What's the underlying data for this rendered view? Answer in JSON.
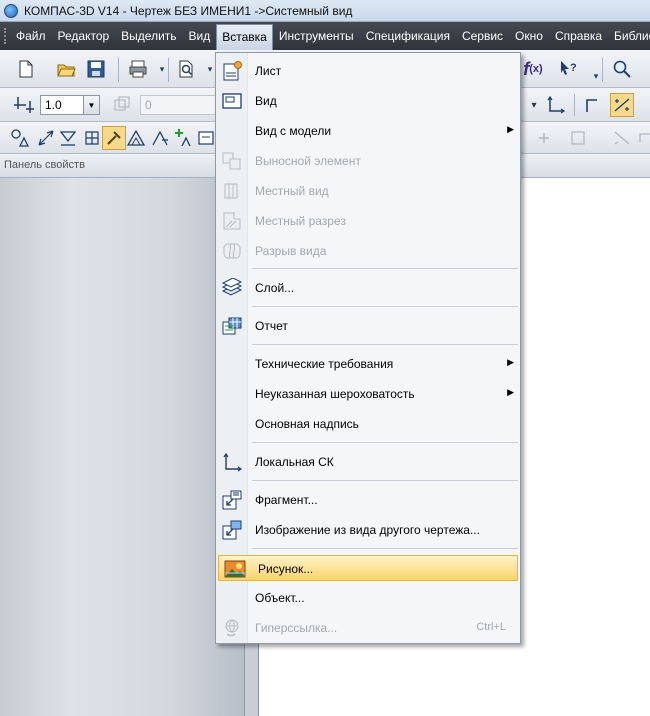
{
  "window": {
    "title": "КОМПАС-3D V14 - Чертеж БЕЗ ИМЕНИ1 ->Системный вид"
  },
  "menubar": {
    "items": [
      {
        "label": "Файл"
      },
      {
        "label": "Редактор"
      },
      {
        "label": "Выделить"
      },
      {
        "label": "Вид"
      },
      {
        "label": "Вставка"
      },
      {
        "label": "Инструменты"
      },
      {
        "label": "Спецификация"
      },
      {
        "label": "Сервис"
      },
      {
        "label": "Окно"
      },
      {
        "label": "Справка"
      },
      {
        "label": "Библиотек"
      }
    ],
    "active": "Вставка"
  },
  "toolbar2": {
    "scale_value": "1.0",
    "angle_value": "0"
  },
  "panel": {
    "title": "Панель свойств"
  },
  "insert_menu": {
    "items": [
      {
        "label": "Лист",
        "icon": "sheet-icon",
        "enabled": true
      },
      {
        "label": "Вид",
        "icon": "view-icon",
        "enabled": true
      },
      {
        "label": "Вид с модели",
        "icon": "",
        "enabled": true,
        "submenu": true
      },
      {
        "label": "Выносной элемент",
        "icon": "detail-element-icon",
        "enabled": false
      },
      {
        "label": "Местный вид",
        "icon": "local-view-icon",
        "enabled": false
      },
      {
        "label": "Местный разрез",
        "icon": "local-section-icon",
        "enabled": false
      },
      {
        "label": "Разрыв вида",
        "icon": "view-break-icon",
        "enabled": false
      },
      {
        "label": "Слой...",
        "icon": "layer-icon",
        "enabled": true
      },
      {
        "label": "Отчет",
        "icon": "report-icon",
        "enabled": true
      },
      {
        "label": "Технические требования",
        "icon": "",
        "enabled": true,
        "submenu": true
      },
      {
        "label": "Неуказанная шероховатость",
        "icon": "",
        "enabled": true,
        "submenu": true
      },
      {
        "label": "Основная надпись",
        "icon": "",
        "enabled": true
      },
      {
        "label": "Локальная СК",
        "icon": "local-cs-icon",
        "enabled": true
      },
      {
        "label": "Фрагмент...",
        "icon": "fragment-icon",
        "enabled": true
      },
      {
        "label": "Изображение из вида другого чертежа...",
        "icon": "image-from-view-icon",
        "enabled": true
      },
      {
        "label": "Рисунок...",
        "icon": "picture-icon",
        "enabled": true,
        "highlighted": true
      },
      {
        "label": "Объект...",
        "icon": "",
        "enabled": true
      },
      {
        "label": "Гиперссылка...",
        "icon": "hyperlink-icon",
        "enabled": false,
        "shortcut": "Ctrl+L"
      }
    ],
    "submenu_arrow": "▶"
  },
  "colors": {
    "menubar_bg": "#3a3f46",
    "highlight": "#fbd46a",
    "disabled_text": "#a3a8ae"
  }
}
